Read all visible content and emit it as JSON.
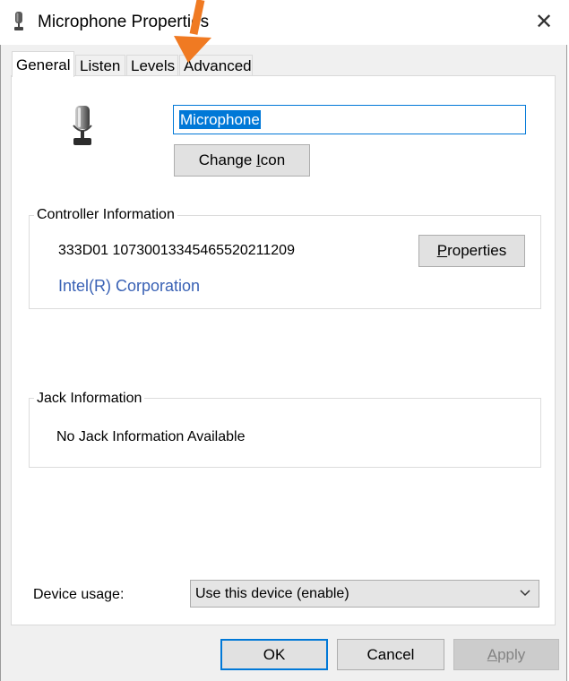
{
  "window": {
    "title": "Microphone Properties",
    "close_symbol": "✕"
  },
  "tabs": [
    {
      "label": "General",
      "active": true
    },
    {
      "label": "Listen",
      "active": false
    },
    {
      "label": "Levels",
      "active": false
    },
    {
      "label": "Advanced",
      "active": false
    }
  ],
  "general": {
    "device_name": "Microphone",
    "change_icon_label_pre": "Change ",
    "change_icon_label_key": "I",
    "change_icon_label_post": "con",
    "icon": "microphone-icon"
  },
  "controller": {
    "group_label": "Controller Information",
    "id": "333D01 10730013345465520211209",
    "vendor": "Intel(R) Corporation",
    "properties_key": "P",
    "properties_rest": "roperties"
  },
  "jack": {
    "group_label": "Jack Information",
    "text": "No Jack Information Available"
  },
  "device_usage": {
    "label": "Device usage:",
    "selected": "Use this device (enable)"
  },
  "footer": {
    "ok": "OK",
    "cancel": "Cancel",
    "apply_key": "A",
    "apply_rest": "pply"
  },
  "colors": {
    "accent": "#0078d7",
    "link": "#3a62b5",
    "annotation_arrow": "#f07a22"
  }
}
